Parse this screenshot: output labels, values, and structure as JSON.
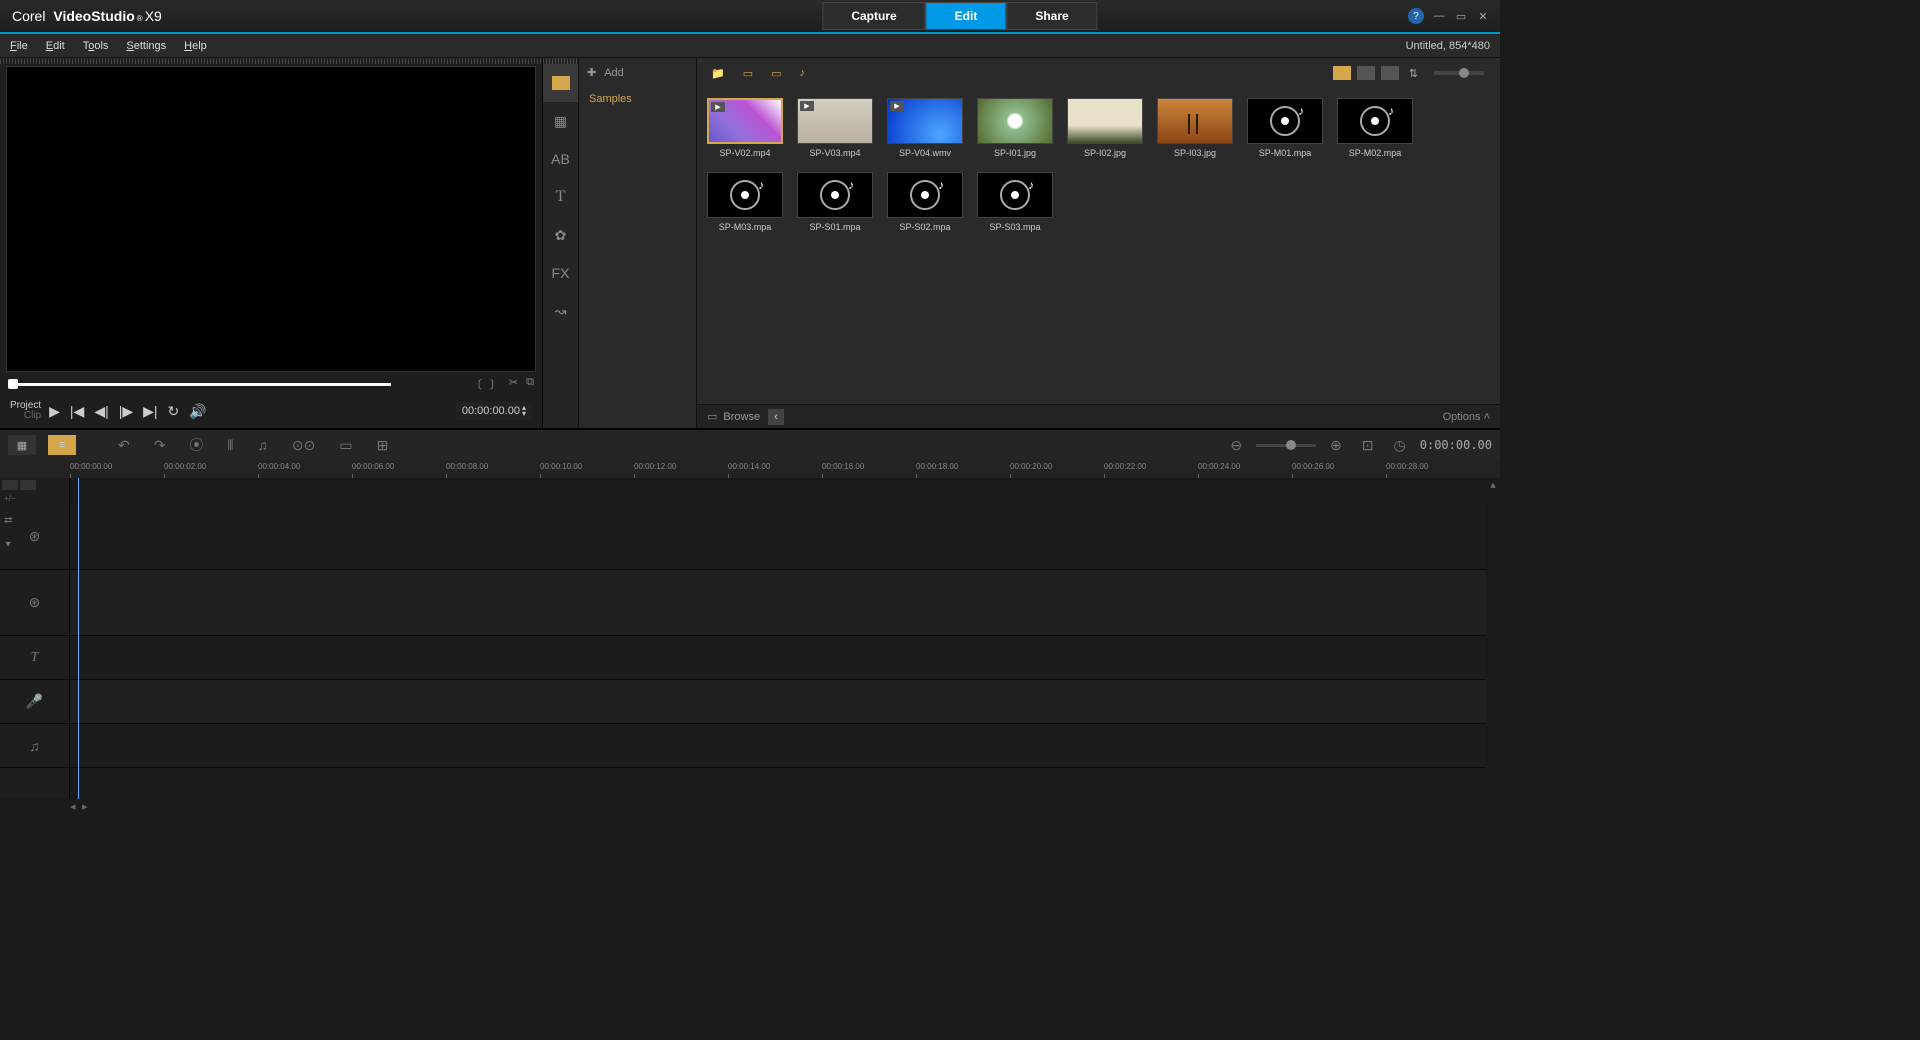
{
  "app": {
    "brand": "Corel",
    "name": "VideoStudio",
    "version": "X9"
  },
  "modes": [
    {
      "label": "Capture",
      "active": false
    },
    {
      "label": "Edit",
      "active": true
    },
    {
      "label": "Share",
      "active": false
    }
  ],
  "menu": [
    {
      "label": "File",
      "key": "F"
    },
    {
      "label": "Edit",
      "key": "E"
    },
    {
      "label": "Tools",
      "key": "T"
    },
    {
      "label": "Settings",
      "key": "S"
    },
    {
      "label": "Help",
      "key": "H"
    }
  ],
  "project": {
    "title": "Untitled, 854*480"
  },
  "preview": {
    "mode_labels": {
      "project": "Project",
      "clip": "Clip"
    },
    "timecode": "00:00:00.00"
  },
  "library": {
    "add_label": "Add",
    "folder": "Samples",
    "browse_label": "Browse",
    "options_label": "Options",
    "tabs": [
      "media",
      "transition",
      "title",
      "text",
      "graphic",
      "filter",
      "path"
    ],
    "filters": [
      "folder",
      "video",
      "photo",
      "audio"
    ],
    "items": [
      {
        "name": "SP-V02.mp4",
        "type": "video",
        "thumb": "thumb-v02",
        "selected": true
      },
      {
        "name": "SP-V03.mp4",
        "type": "video",
        "thumb": "thumb-v03"
      },
      {
        "name": "SP-V04.wmv",
        "type": "video",
        "thumb": "thumb-v04"
      },
      {
        "name": "SP-I01.jpg",
        "type": "image",
        "thumb": "thumb-i01"
      },
      {
        "name": "SP-I02.jpg",
        "type": "image",
        "thumb": "thumb-i02"
      },
      {
        "name": "SP-I03.jpg",
        "type": "image",
        "thumb": "thumb-i03"
      },
      {
        "name": "SP-M01.mpa",
        "type": "audio"
      },
      {
        "name": "SP-M02.mpa",
        "type": "audio"
      },
      {
        "name": "SP-M03.mpa",
        "type": "audio"
      },
      {
        "name": "SP-S01.mpa",
        "type": "audio"
      },
      {
        "name": "SP-S02.mpa",
        "type": "audio"
      },
      {
        "name": "SP-S03.mpa",
        "type": "audio"
      }
    ]
  },
  "timeline": {
    "timecode": "0:00:00.00",
    "ruler_marks": [
      "00:00:00.00",
      "00:00:02.00",
      "00:00:04.00",
      "00:00:06.00",
      "00:00:08.00",
      "00:00:10.00",
      "00:00:12.00",
      "00:00:14.00",
      "00:00:16.00",
      "00:00:18.00",
      "00:00:20.00",
      "00:00:22.00",
      "00:00:24.00",
      "00:00:26.00",
      "00:00:28.00"
    ],
    "tracks": [
      {
        "type": "video",
        "icon": "film",
        "size": "large"
      },
      {
        "type": "overlay",
        "icon": "film",
        "size": "large"
      },
      {
        "type": "title",
        "icon": "T",
        "size": "small"
      },
      {
        "type": "voice",
        "icon": "mic",
        "size": "small"
      },
      {
        "type": "music",
        "icon": "music",
        "size": "small"
      }
    ]
  }
}
